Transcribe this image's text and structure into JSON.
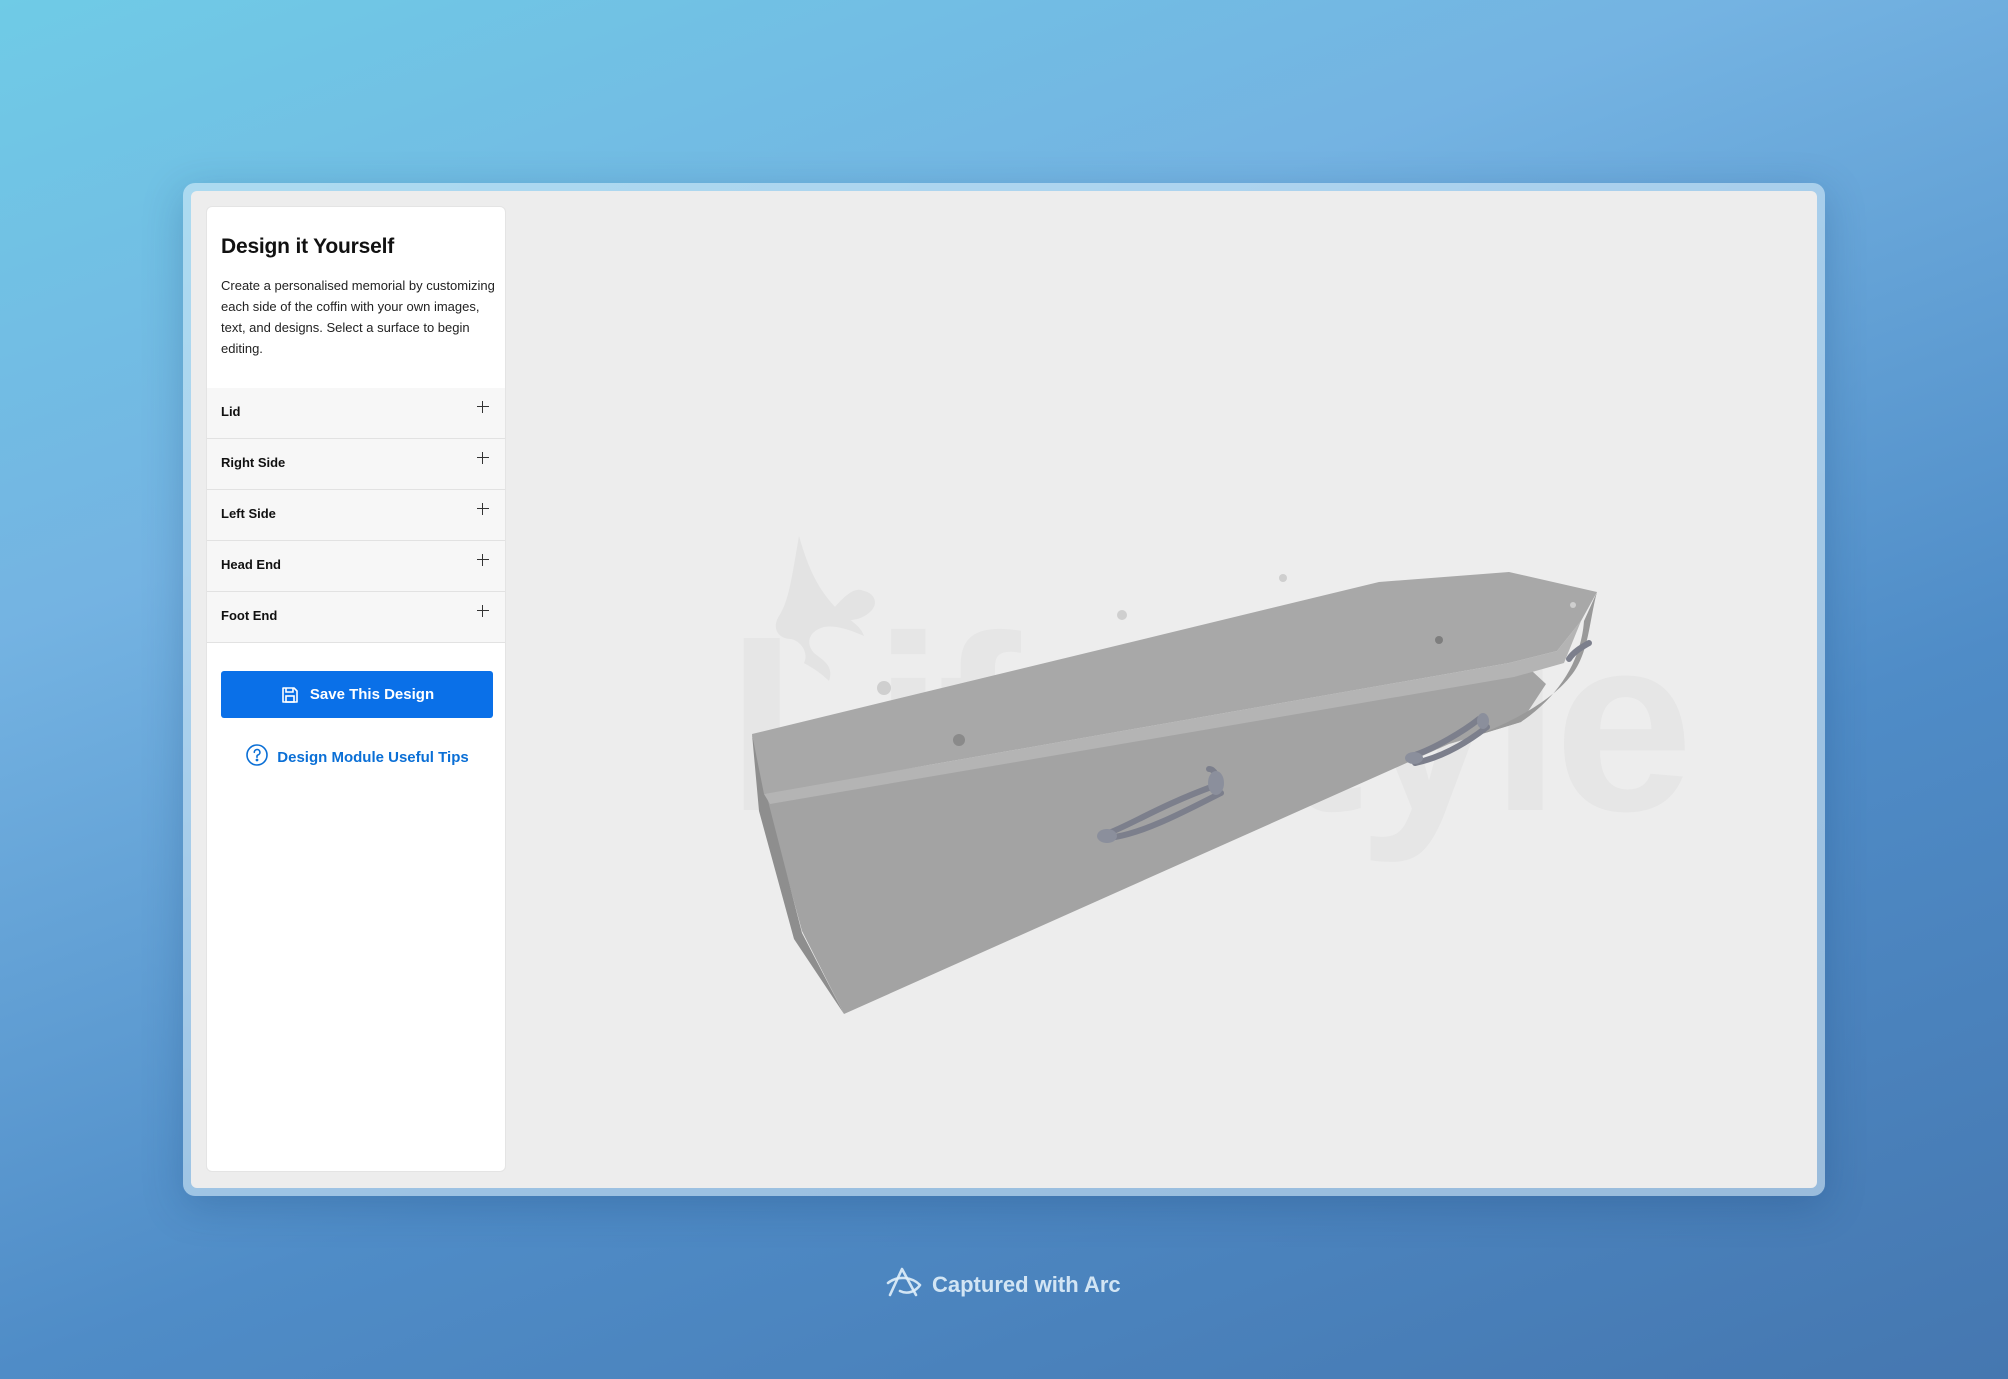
{
  "sidebar": {
    "title": "Design it Yourself",
    "description": "Create a personalised memorial by customizing each side of the coffin with your own images, text, and designs. Select a surface to begin editing.",
    "sections": [
      {
        "label": "Lid"
      },
      {
        "label": "Right Side"
      },
      {
        "label": "Left Side"
      },
      {
        "label": "Head End"
      },
      {
        "label": "Foot End"
      }
    ],
    "save_label": "Save This Design",
    "tips_label": "Design Module Useful Tips"
  },
  "viewport": {
    "watermark_text": "Lifestyle",
    "watermark_icon": "dove-icon",
    "model": "coffin-3d-model"
  },
  "footer": {
    "caption": "Captured with Arc",
    "icon": "arc-logo-icon"
  },
  "colors": {
    "primary_button": "#0a70e8",
    "link": "#0a6fd6",
    "viewport_bg": "#ededed",
    "model_gray": "#a6a6a6"
  }
}
